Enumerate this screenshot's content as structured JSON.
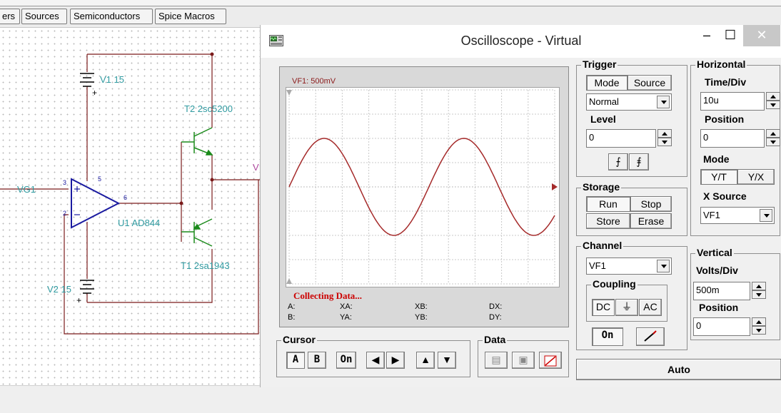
{
  "tabs": [
    "ers",
    "Sources",
    "Semiconductors",
    "Spice Macros"
  ],
  "schematic": {
    "v1": "V1 15",
    "v2": "V2 15",
    "t2": "T2 2sc5200",
    "t1": "T1 2sa1943",
    "u1": "U1 AD844",
    "vg1": "VG1",
    "vf_partial": "V",
    "plus_top": "+",
    "plus_bottom": "+",
    "pin3": "3",
    "pin2": "2",
    "pin6": "6",
    "pin5": "5",
    "colors": {
      "wire": "#7a1a1a",
      "label": "#2f9aa0",
      "opamp": "#1a1aa0",
      "transistor": "#1a8a1a"
    }
  },
  "window": {
    "title": "Oscilloscope - Virtual",
    "icon": "oscilloscope-app-icon",
    "minimize": "–",
    "maximize": "☐",
    "close": "✕"
  },
  "screen": {
    "channel_label": "VF1: 500mV",
    "status": "Collecting Data...",
    "readouts": {
      "a": "A:",
      "b": "B:",
      "xa": "XA:",
      "ya": "YA:",
      "xb": "XB:",
      "yb": "YB:",
      "dx": "DX:",
      "dy": "DY:"
    },
    "trace_color": "#a52a2a",
    "trace_cycles": 2,
    "trace_amplitude_div": 2
  },
  "trigger": {
    "title": "Trigger",
    "mode_btn": "Mode",
    "source_btn": "Source",
    "mode_value": "Normal",
    "level_label": "Level",
    "level_value": "0",
    "rising_icon": "rising-edge-icon",
    "falling_icon": "falling-edge-icon"
  },
  "storage": {
    "title": "Storage",
    "run": "Run",
    "stop": "Stop",
    "store": "Store",
    "erase": "Erase"
  },
  "horizontal": {
    "title": "Horizontal",
    "timediv_label": "Time/Div",
    "timediv_value": "10u",
    "position_label": "Position",
    "position_value": "0",
    "mode_label": "Mode",
    "yt": "Y/T",
    "yx": "Y/X",
    "xsource_label": "X Source",
    "xsource_value": "VF1"
  },
  "channel": {
    "title": "Channel",
    "value": "VF1",
    "coupling_title": "Coupling",
    "dc": "DC",
    "gnd": "⏚",
    "ac": "AC",
    "on": "On",
    "probe_icon": "probe-icon"
  },
  "vertical": {
    "title": "Vertical",
    "voltsdiv_label": "Volts/Div",
    "voltsdiv_value": "500m",
    "position_label": "Position",
    "position_value": "0"
  },
  "cursor": {
    "title": "Cursor",
    "a": "A",
    "b": "B",
    "on": "On"
  },
  "data_group": {
    "title": "Data"
  },
  "auto": "Auto"
}
